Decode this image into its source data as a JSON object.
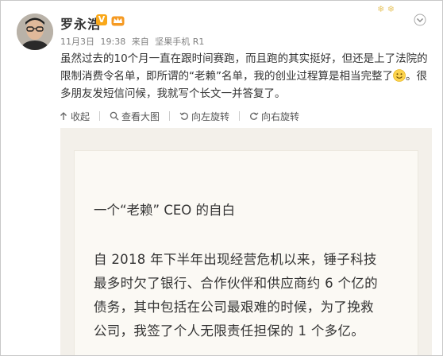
{
  "post": {
    "author": "罗永浩",
    "verified_badge": "V",
    "date": "11月3日",
    "time": "19:38",
    "source_prefix": "来自",
    "source_device": "坚果手机 R1",
    "text_part1": "虽然过去的10个月一直在跟时间赛跑，而且跑的其实挺好，但还是上了法院的限制消费令名单，即所谓的“老赖”名单，我的创业过程算是相当完整了",
    "text_part2": "。很多朋友发短信问候，我就写个长文一并答复了。",
    "emoji_icon": "smile-emoji-icon",
    "top_deco": "❄ ❄"
  },
  "toolbar": {
    "collapse_label": "收起",
    "view_image_label": "查看大图",
    "rotate_left_label": "向左旋转",
    "rotate_right_label": "向右旋转"
  },
  "letter": {
    "title": "一个“老赖” CEO 的自白",
    "line1": "自 2018 年下半年出现经营危机以来，锤子科技",
    "line2": "最多时欠了银行、合作伙伴和供应商约 6 个亿的",
    "line3": "债务，其中包括在公司最艰难的时候，为了挽救",
    "line4": "公司，我签了个人无限责任担保的 1 个多亿。"
  },
  "colors": {
    "meta_gray": "#808080",
    "verified_orange": "#f9a81a",
    "letter_bg": "#f3f0ea"
  }
}
